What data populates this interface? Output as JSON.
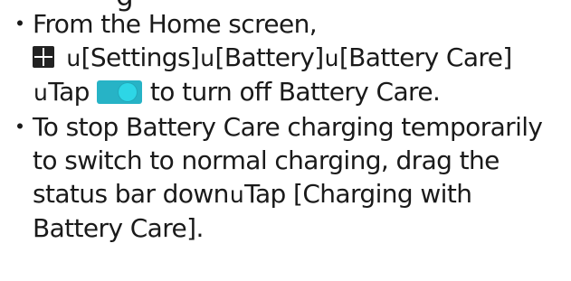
{
  "heading_fragment": "g",
  "bullet_symbol": "・",
  "arrow_symbol": "u",
  "icons": {
    "apps": "apps-grid-icon",
    "toggle": "toggle-on-icon"
  },
  "colors": {
    "toggle_track": "#27b3c6",
    "toggle_knob": "#2dd6e6"
  },
  "bullets": [
    {
      "line1": "From the Home screen,",
      "menu1": "[Settings]",
      "menu2": "[Battery]",
      "menu3": "[Battery Care]",
      "tap": "Tap",
      "tail": "to turn off Battery Care."
    },
    {
      "line1": "To stop Battery Care charging temporarily",
      "line2": "to switch to normal charging, drag the",
      "line3_start": "status bar down",
      "line3_end": "Tap [Charging with",
      "line4": "Battery Care]."
    }
  ]
}
